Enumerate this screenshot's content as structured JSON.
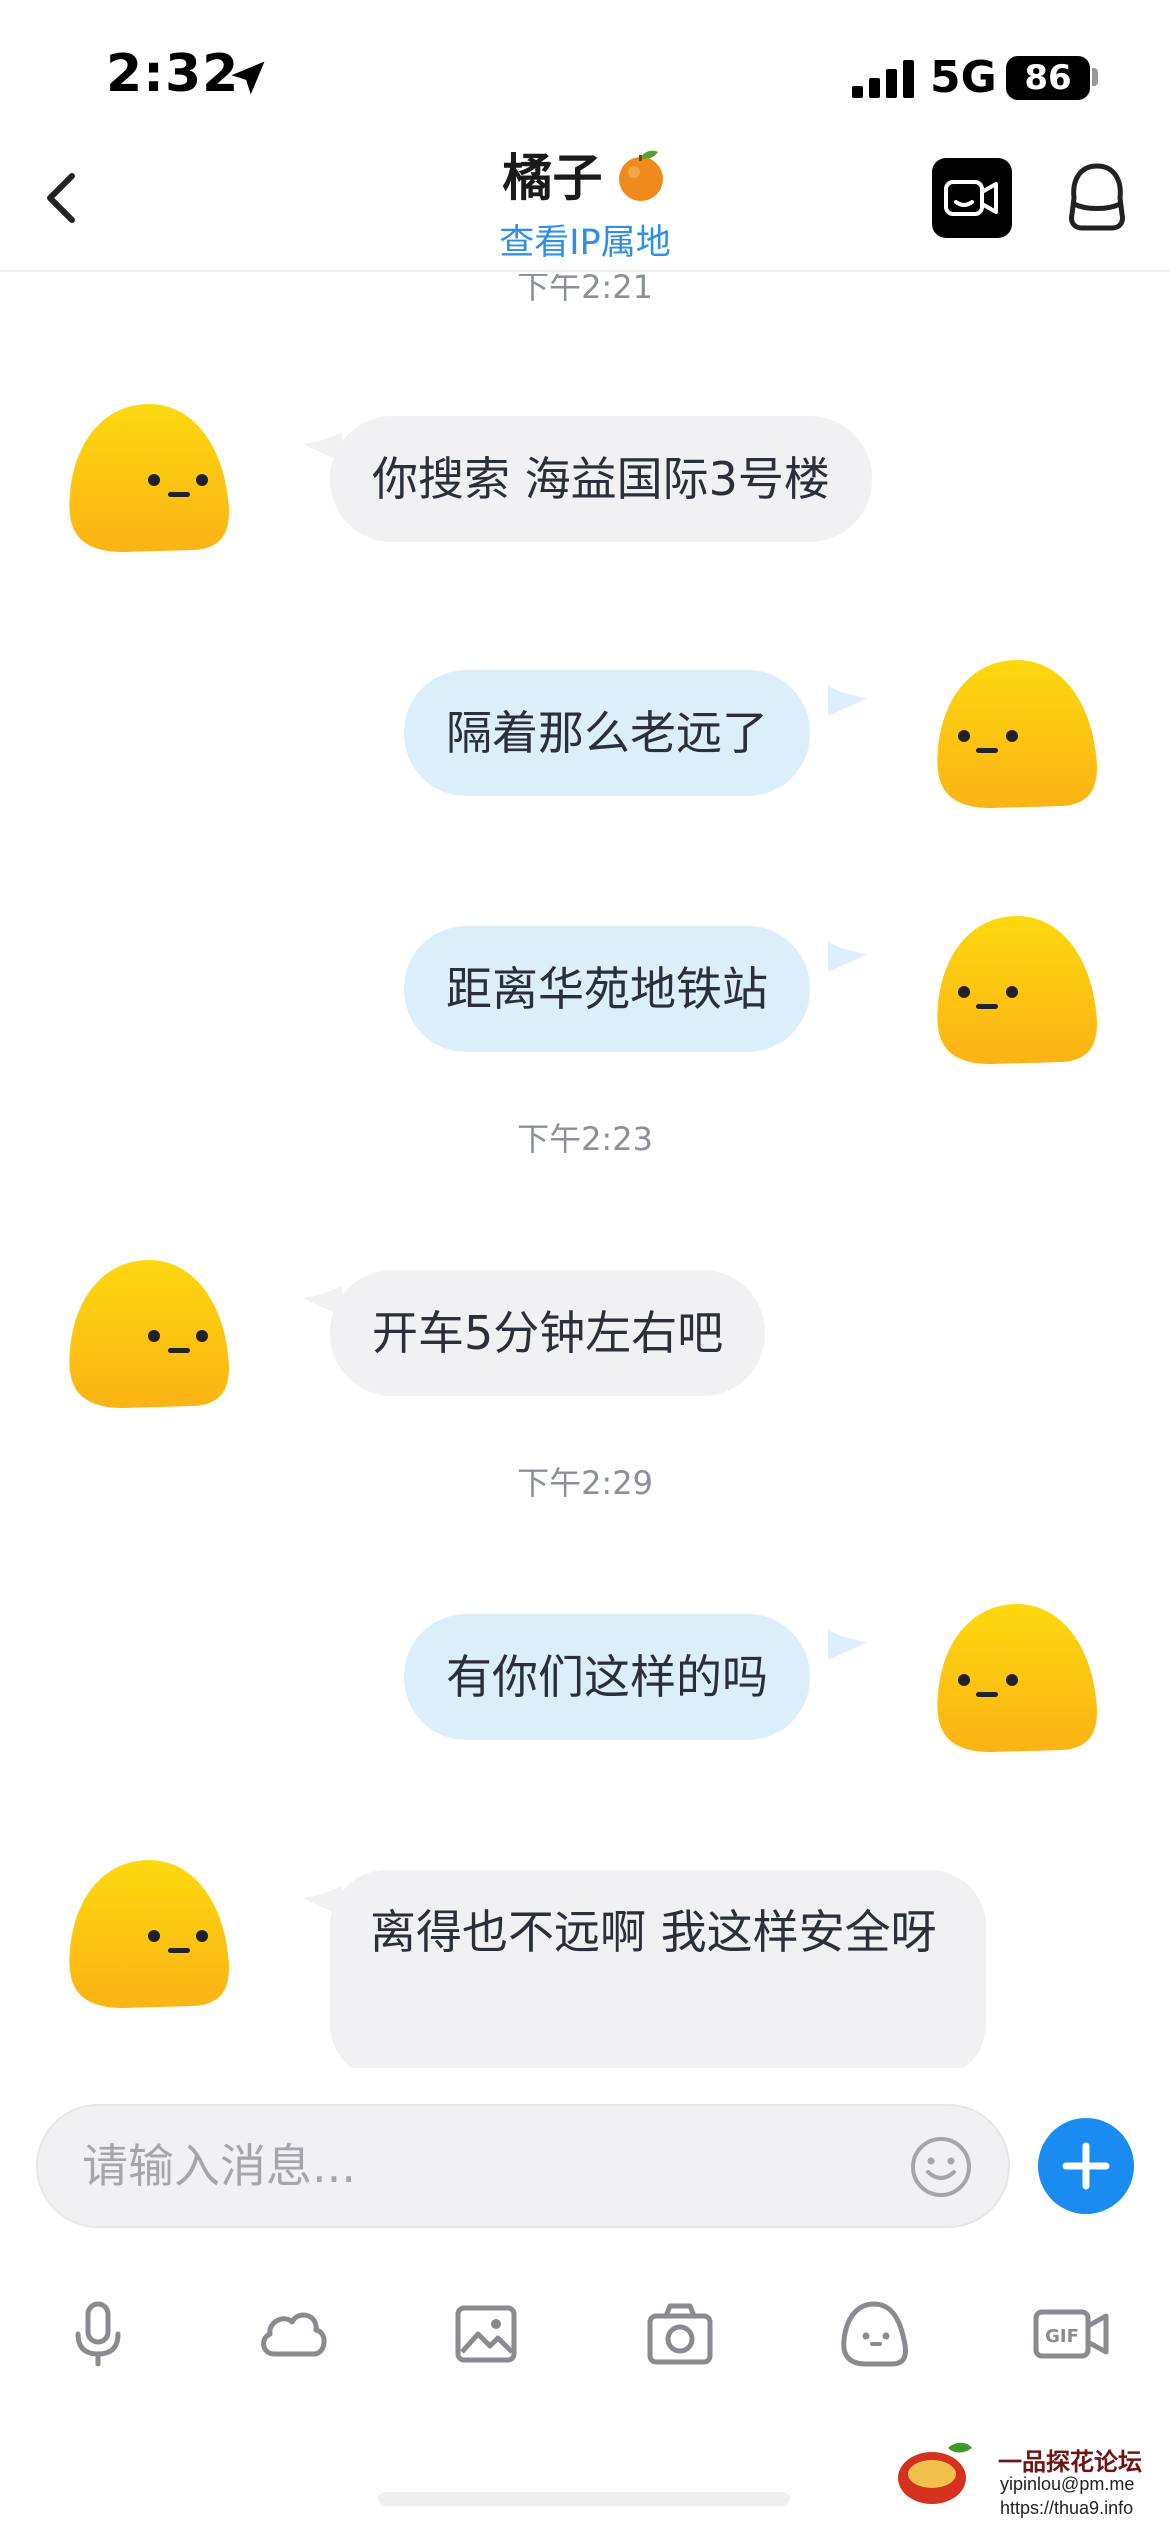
{
  "status_bar": {
    "time": "2:32",
    "network": "5G",
    "battery": "86"
  },
  "header": {
    "title": "橘子",
    "subtitle": "查看IP属地"
  },
  "messages": [
    {
      "type": "timestamp",
      "text": "下午2:21"
    },
    {
      "type": "message",
      "side": "in",
      "text": "你搜索 海益国际3号楼"
    },
    {
      "type": "message",
      "side": "out",
      "text": "隔着那么老远了"
    },
    {
      "type": "message",
      "side": "out",
      "text": "距离华苑地铁站"
    },
    {
      "type": "timestamp",
      "text": "下午2:23"
    },
    {
      "type": "message",
      "side": "in",
      "text": "开车5分钟左右吧"
    },
    {
      "type": "timestamp",
      "text": "下午2:29"
    },
    {
      "type": "message",
      "side": "out",
      "text": "有你们这样的吗"
    },
    {
      "type": "message",
      "side": "in",
      "text": "离得也不远啊 我这样安全呀"
    }
  ],
  "input": {
    "placeholder": "请输入消息..."
  },
  "toolbar": [
    "mic-icon",
    "cloud-icon",
    "image-icon",
    "camera-icon",
    "sticker-icon",
    "gif-icon"
  ],
  "watermark": {
    "title": "一品探花论坛",
    "email": "yipinlou@pm.me",
    "url": "https://thua9.info"
  },
  "colors": {
    "accent": "#1a8cf1",
    "subtitle": "#2f8fe8",
    "incoming_bubble": "#f1f1f3",
    "outgoing_bubble": "#ddeefb",
    "avatar": "#fbc10a"
  }
}
